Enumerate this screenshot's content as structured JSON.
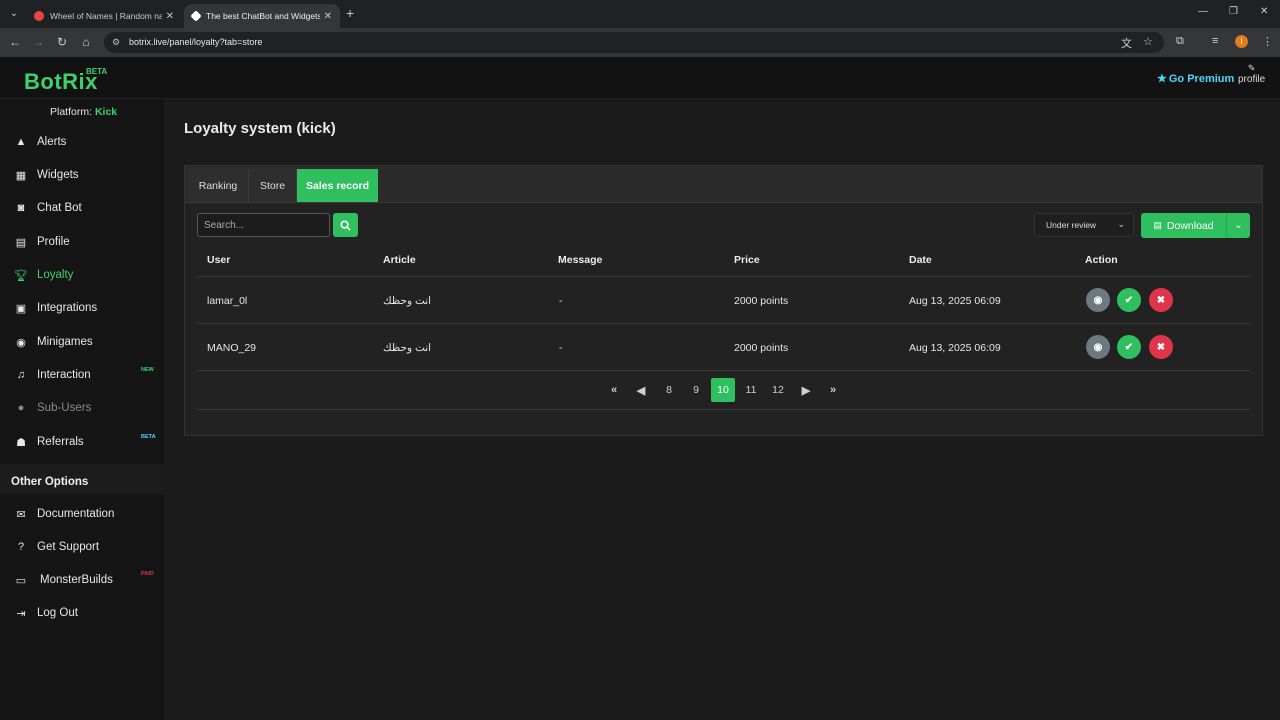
{
  "browser": {
    "tabs": [
      {
        "title": "Wheel of Names | Random nam",
        "favicon_color": "#e8453c"
      },
      {
        "title": "The best ChatBot and Widgets",
        "favicon_color": "#ffffff"
      }
    ],
    "url": "botrix.live/panel/loyalty?tab=store",
    "avatar_letter": "I"
  },
  "header": {
    "logo": "BotRix",
    "logo_badge": "BETA",
    "premium_label": "Go Premium",
    "profile_label": "profile"
  },
  "sidebar": {
    "platform_label": "Platform:",
    "platform_value": "Kick",
    "items": [
      {
        "label": "Alerts",
        "icon": "warning-icon"
      },
      {
        "label": "Widgets",
        "icon": "grid-icon"
      },
      {
        "label": "Chat Bot",
        "icon": "robot-icon"
      },
      {
        "label": "Profile",
        "icon": "id-card-icon"
      },
      {
        "label": "Loyalty",
        "icon": "trophy-icon"
      },
      {
        "label": "Integrations",
        "icon": "integrations-icon"
      },
      {
        "label": "Minigames",
        "icon": "gamepad-icon"
      },
      {
        "label": "Interaction",
        "icon": "music-icon",
        "badge": "NEW"
      },
      {
        "label": "Sub-Users",
        "icon": "users-icon"
      },
      {
        "label": "Referrals",
        "icon": "referrals-icon",
        "badge": "BETA"
      }
    ],
    "other_options_title": "Other Options",
    "other_items": [
      {
        "label": "Documentation",
        "icon": "scroll-icon"
      },
      {
        "label": "Get Support",
        "icon": "question-icon"
      },
      {
        "label": "MonsterBuilds",
        "icon": "laptop-icon",
        "badge": "PAID"
      },
      {
        "label": "Log Out",
        "icon": "logout-icon"
      }
    ],
    "colors": {
      "accent": "#3fd16b",
      "new_badge": "#3fd16b",
      "beta_badge": "#4ad6ff",
      "paid_badge": "#e0344b"
    }
  },
  "main": {
    "title": "Loyalty system (kick)",
    "tabs": [
      "Ranking",
      "Store",
      "Sales record"
    ],
    "search_placeholder": "Search...",
    "filter_value": "Under review",
    "download_label": "Download",
    "columns": [
      "User",
      "Article",
      "Message",
      "Price",
      "Date",
      "Action"
    ],
    "rows": [
      {
        "user": "lamar_0l",
        "article": "انت وحظك",
        "message": "-",
        "price": "2000 points",
        "date": "Aug 13, 2025 06:09"
      },
      {
        "user": "MANO_29",
        "article": "انت وحظك",
        "message": "-",
        "price": "2000 points",
        "date": "Aug 13, 2025 06:09"
      }
    ],
    "pagination": {
      "pages": [
        "8",
        "9",
        "10",
        "11",
        "12"
      ],
      "current": "10"
    },
    "colors": {
      "green": "#2fbf5f",
      "red": "#e0344b",
      "gray": "#6c7a80"
    }
  }
}
